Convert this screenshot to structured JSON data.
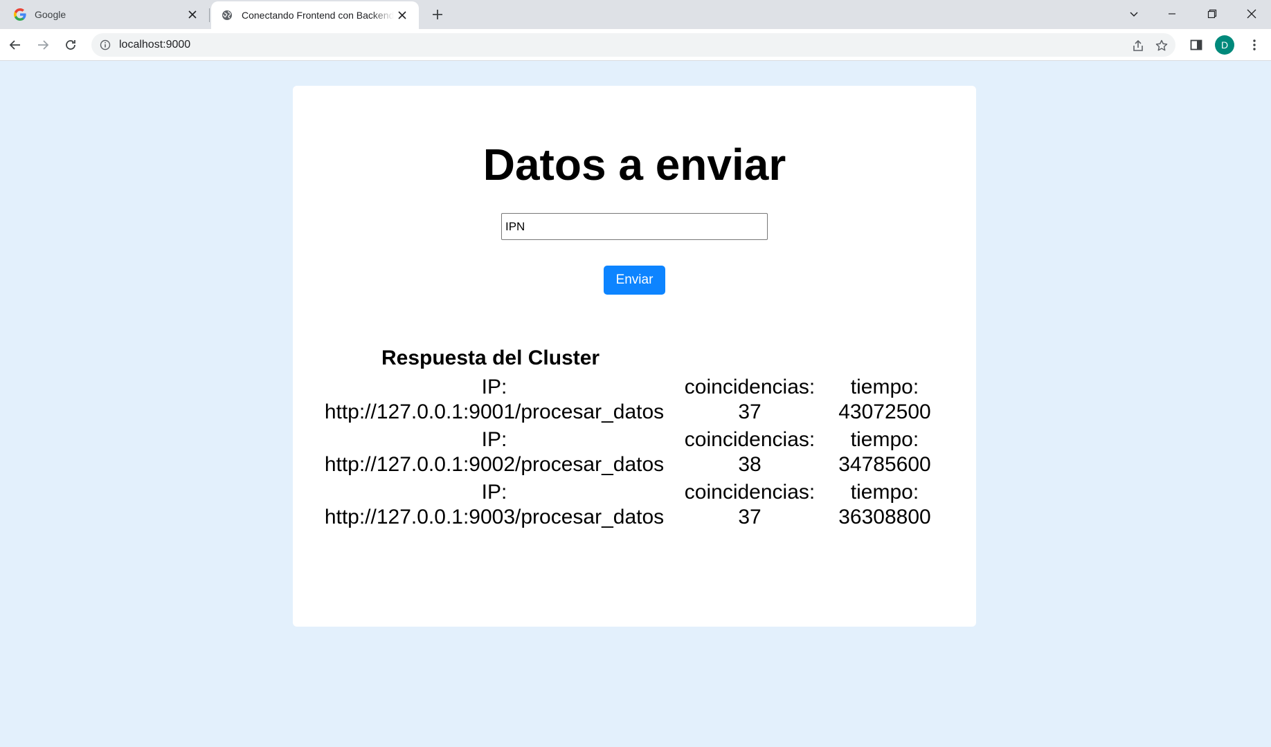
{
  "browser": {
    "tabs": [
      {
        "title": "Google",
        "icon": "google-icon",
        "active": false
      },
      {
        "title": "Conectando Frontend con Backend",
        "icon": "globe-icon",
        "active": true
      }
    ],
    "url": "localhost:9000",
    "profile_initial": "D",
    "profile_color": "#00897b"
  },
  "page": {
    "title": "Datos a enviar",
    "input_value": "IPN",
    "send_button_label": "Enviar",
    "button_color": "#0d84ff",
    "background_color": "#e3f0fc",
    "results": {
      "title": "Respuesta del Cluster",
      "rows": [
        {
          "ip_label": "IP:",
          "ip_value": "http://127.0.0.1:9001/procesar_datos",
          "coincidencias_label": "coincidencias:",
          "coincidencias_value": "37",
          "tiempo_label": "tiempo:",
          "tiempo_value": "43072500"
        },
        {
          "ip_label": "IP:",
          "ip_value": "http://127.0.0.1:9002/procesar_datos",
          "coincidencias_label": "coincidencias:",
          "coincidencias_value": "38",
          "tiempo_label": "tiempo:",
          "tiempo_value": "34785600"
        },
        {
          "ip_label": "IP:",
          "ip_value": "http://127.0.0.1:9003/procesar_datos",
          "coincidencias_label": "coincidencias:",
          "coincidencias_value": "37",
          "tiempo_label": "tiempo:",
          "tiempo_value": "36308800"
        }
      ]
    }
  }
}
